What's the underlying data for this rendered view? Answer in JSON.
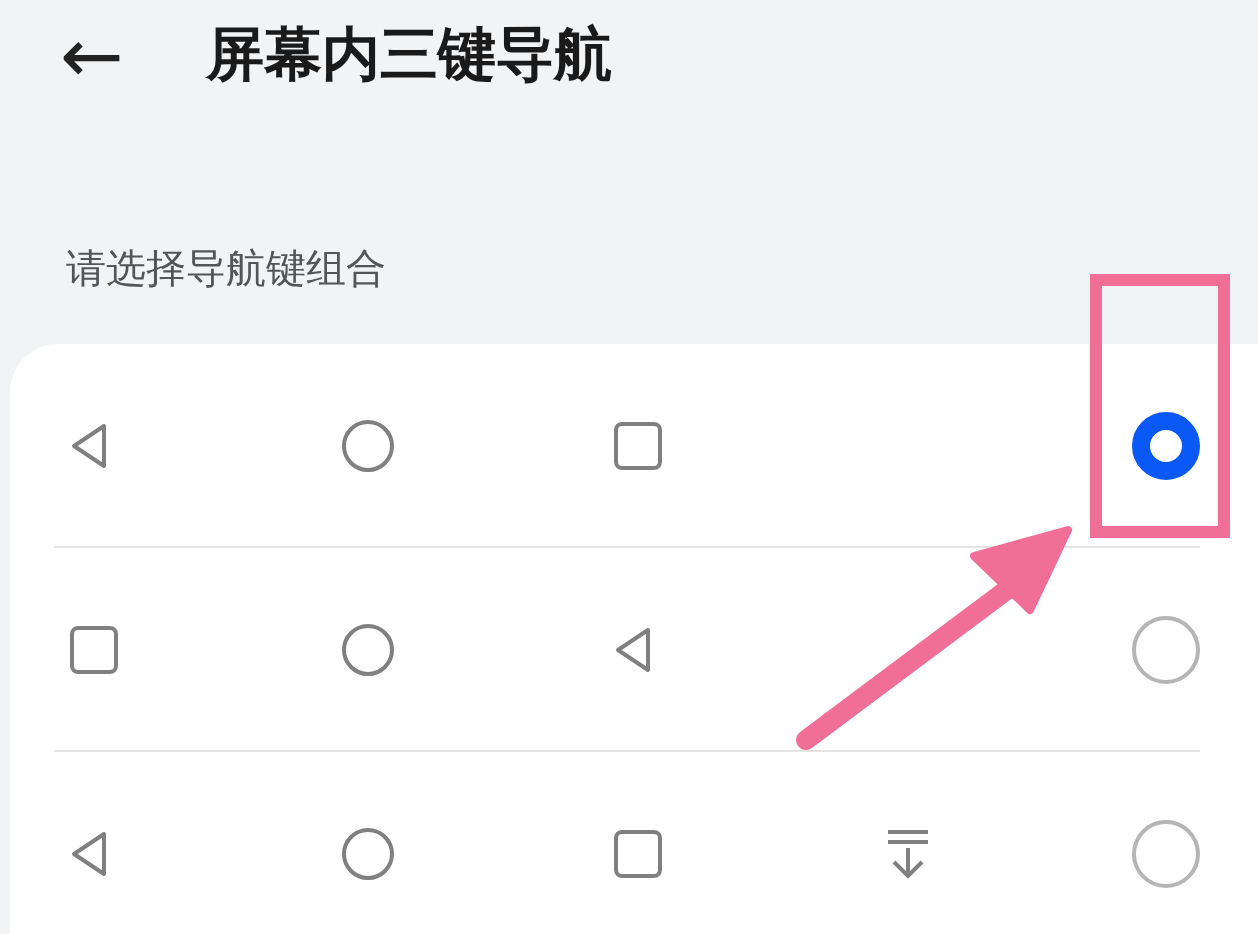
{
  "header": {
    "back_button": "←",
    "title": "屏幕内三键导航"
  },
  "section_label": "请选择导航键组合",
  "options": [
    {
      "keys": [
        {
          "kind": "back"
        },
        {
          "kind": "home"
        },
        {
          "kind": "recent"
        }
      ],
      "selected": true
    },
    {
      "keys": [
        {
          "kind": "recent"
        },
        {
          "kind": "home"
        },
        {
          "kind": "back"
        }
      ],
      "selected": false
    },
    {
      "keys": [
        {
          "kind": "back"
        },
        {
          "kind": "home"
        },
        {
          "kind": "recent"
        },
        {
          "kind": "hide"
        }
      ],
      "selected": false
    }
  ]
}
